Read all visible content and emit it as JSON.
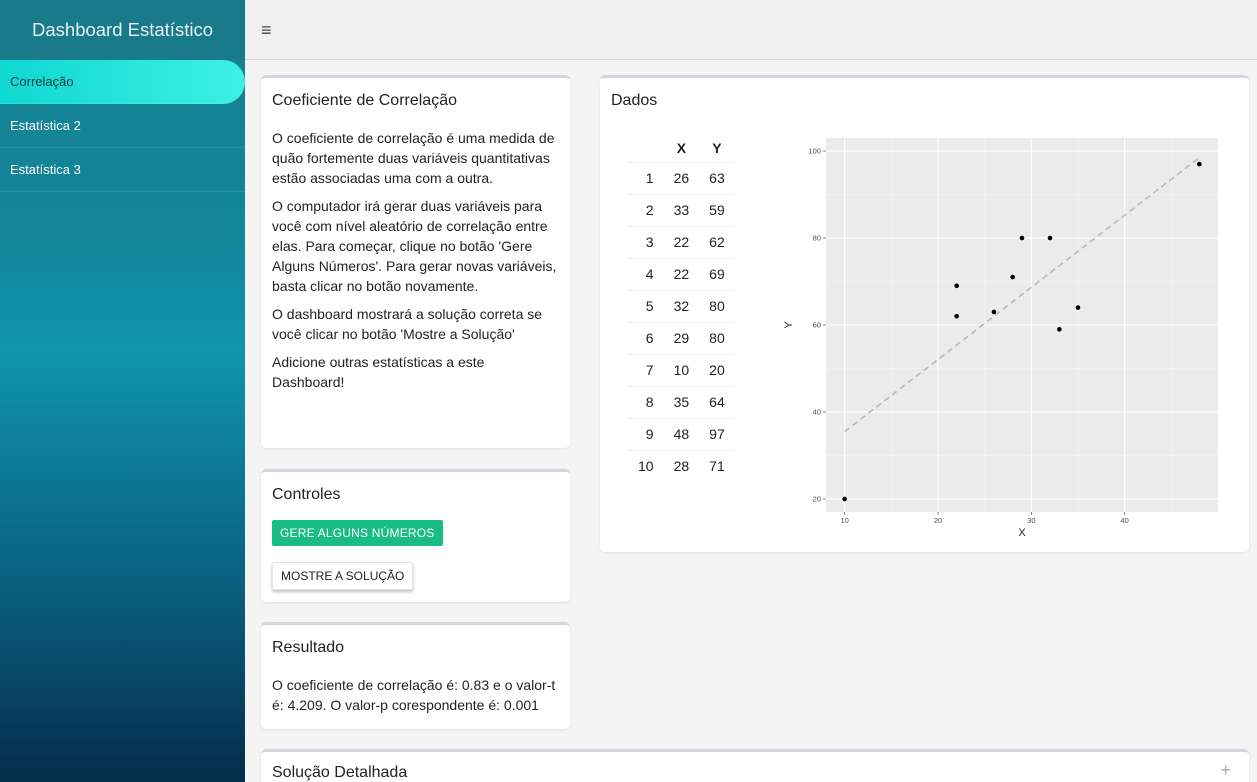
{
  "sidebar": {
    "brand": "Dashboard Estatístico",
    "items": [
      {
        "label": "Correlação",
        "active": true
      },
      {
        "label": "Estatística 2"
      },
      {
        "label": "Estatística 3"
      }
    ]
  },
  "header": {
    "menu_icon": "hamburger-icon"
  },
  "coef_box": {
    "title": "Coeficiente de Correlação",
    "paragraphs": [
      "O coeficiente de correlação é uma medida de quão fortemente duas variáveis quantitativas estão associadas uma com a outra.",
      "O computador irá gerar duas variáveis para você com nível aleatório de correlação entre elas. Para começar, clique no botão 'Gere Alguns Números'. Para gerar novas variáveis, basta clicar no botão novamente.",
      "O dashboard mostrará a solução correta se você clicar no botão 'Mostre a Solução'",
      "Adicione outras estatísticas a este Dashboard!"
    ]
  },
  "controls_box": {
    "title": "Controles",
    "generate_label": "GERE ALGUNS NÚMEROS",
    "solution_label": "MOSTRE A SOLUÇÃO"
  },
  "result_box": {
    "title": "Resultado",
    "text": "O coeficiente de correlação é: 0.83 e o valor-t é: 4.209. O valor-p corespondente é: 0.001"
  },
  "data_box": {
    "title": "Dados",
    "columns": [
      "X",
      "Y"
    ],
    "rows": [
      {
        "i": "1",
        "x": "26",
        "y": "63"
      },
      {
        "i": "2",
        "x": "33",
        "y": "59"
      },
      {
        "i": "3",
        "x": "22",
        "y": "62"
      },
      {
        "i": "4",
        "x": "22",
        "y": "69"
      },
      {
        "i": "5",
        "x": "32",
        "y": "80"
      },
      {
        "i": "6",
        "x": "29",
        "y": "80"
      },
      {
        "i": "7",
        "x": "10",
        "y": "20"
      },
      {
        "i": "8",
        "x": "35",
        "y": "64"
      },
      {
        "i": "9",
        "x": "48",
        "y": "97"
      },
      {
        "i": "10",
        "x": "28",
        "y": "71"
      }
    ]
  },
  "detail_box": {
    "title": "Solução Detalhada",
    "expand_icon": "plus-icon"
  },
  "chart_data": {
    "type": "scatter",
    "xlabel": "X",
    "ylabel": "Y",
    "xlim": [
      8,
      50
    ],
    "ylim": [
      17,
      103
    ],
    "xticks": [
      10,
      20,
      30,
      40
    ],
    "yticks": [
      20,
      40,
      60,
      80,
      100
    ],
    "grid": true,
    "background": "#ebebeb",
    "points": [
      {
        "x": 26,
        "y": 63
      },
      {
        "x": 33,
        "y": 59
      },
      {
        "x": 22,
        "y": 62
      },
      {
        "x": 22,
        "y": 69
      },
      {
        "x": 32,
        "y": 80
      },
      {
        "x": 29,
        "y": 80
      },
      {
        "x": 10,
        "y": 20
      },
      {
        "x": 35,
        "y": 64
      },
      {
        "x": 48,
        "y": 97
      },
      {
        "x": 28,
        "y": 71
      }
    ],
    "trendline": {
      "x": [
        10,
        48
      ],
      "y": [
        35.5,
        98.5
      ],
      "style": "dashed",
      "color": "#b8b8b8"
    }
  }
}
